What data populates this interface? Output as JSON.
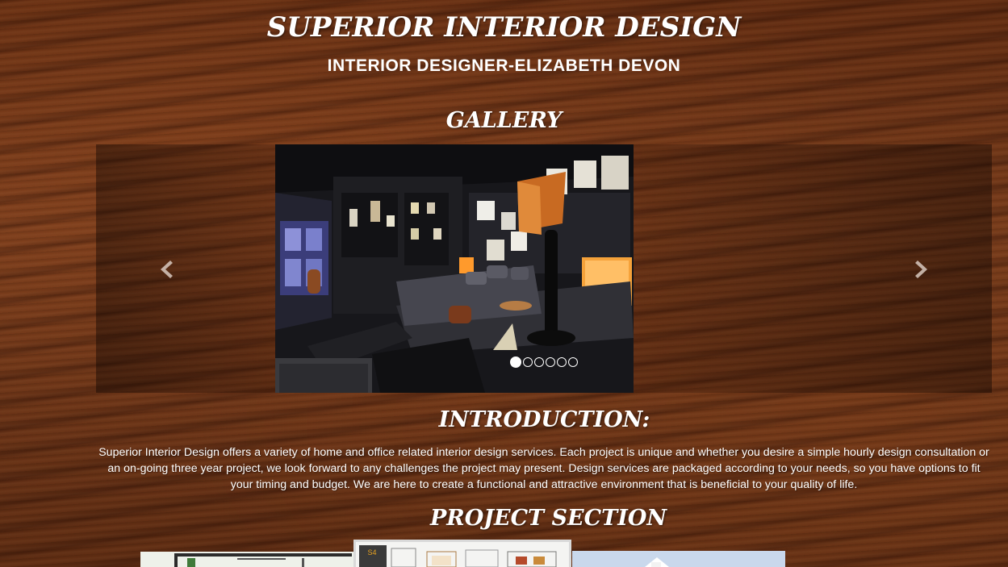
{
  "header": {
    "title": "SUPERIOR INTERIOR DESIGN",
    "subtitle": "INTERIOR DESIGNER-ELIZABETH DEVON"
  },
  "gallery": {
    "heading": "GALLERY",
    "slide_count": 6,
    "active_slide": 1,
    "controls": {
      "prev_icon": "chevron-left-icon",
      "next_icon": "chevron-right-icon"
    }
  },
  "introduction": {
    "heading": "INTRODUCTION:",
    "text": "Superior Interior Design offers a variety of home and office related interior design services. Each project is unique and whether you desire a simple hourly design consultation or an on-going three year project, we look forward to any challenges the project may present. Design services are packaged according to your needs, so you have options to fit your timing and budget. We are here to create a functional and attractive environment that is beneficial to your quality of life."
  },
  "projects": {
    "heading": "PROJECT SECTION",
    "thumbnail_2_logo": "S4"
  },
  "colors": {
    "text": "#ffffff",
    "wood_base": "#6b3316",
    "wood_dark": "#3f1a08"
  }
}
